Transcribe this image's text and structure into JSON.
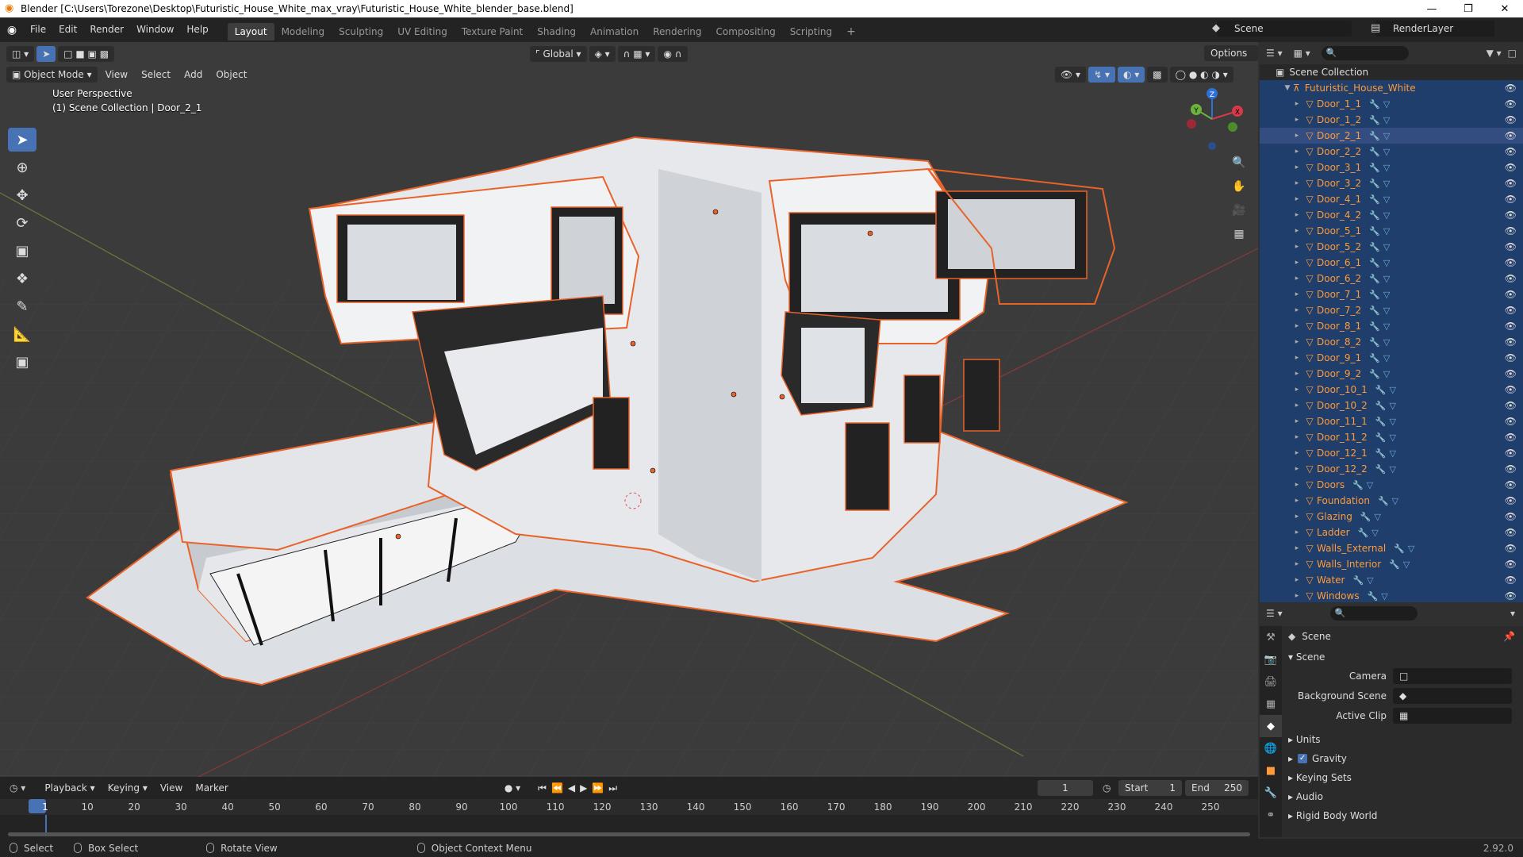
{
  "title": "Blender [C:\\Users\\Torezone\\Desktop\\Futuristic_House_White_max_vray\\Futuristic_House_White_blender_base.blend]",
  "menu": [
    "File",
    "Edit",
    "Render",
    "Window",
    "Help"
  ],
  "workspaces": [
    "Layout",
    "Modeling",
    "Sculpting",
    "UV Editing",
    "Texture Paint",
    "Shading",
    "Animation",
    "Rendering",
    "Compositing",
    "Scripting"
  ],
  "active_workspace": "Layout",
  "scene_name": "Scene",
  "render_layer": "RenderLayer",
  "viewport": {
    "mode": "Object Mode",
    "menus": [
      "View",
      "Select",
      "Add",
      "Object"
    ],
    "transform_orientation": "Global",
    "options_label": "Options",
    "perspective": "User Perspective",
    "collection_info": "(1) Scene Collection | Door_2_1"
  },
  "gizmo_axes": [
    "X",
    "Y",
    "Z"
  ],
  "outliner": {
    "root": "Scene Collection",
    "collection": "Futuristic_House_White",
    "items": [
      "Door_1_1",
      "Door_1_2",
      "Door_2_1",
      "Door_2_2",
      "Door_3_1",
      "Door_3_2",
      "Door_4_1",
      "Door_4_2",
      "Door_5_1",
      "Door_5_2",
      "Door_6_1",
      "Door_6_2",
      "Door_7_1",
      "Door_7_2",
      "Door_8_1",
      "Door_8_2",
      "Door_9_1",
      "Door_9_2",
      "Door_10_1",
      "Door_10_2",
      "Door_11_1",
      "Door_11_2",
      "Door_12_1",
      "Door_12_2",
      "Doors",
      "Foundation",
      "Glazing",
      "Ladder",
      "Walls_External",
      "Walls_Interior",
      "Water",
      "Windows"
    ],
    "selected": "Door_2_1"
  },
  "properties": {
    "context": "Scene",
    "section": "Scene",
    "fields": [
      {
        "label": "Camera",
        "value": ""
      },
      {
        "label": "Background Scene",
        "value": ""
      },
      {
        "label": "Active Clip",
        "value": ""
      }
    ],
    "panels": [
      "Units",
      "Gravity",
      "Keying Sets",
      "Audio",
      "Rigid Body World"
    ],
    "gravity_checked": true
  },
  "timeline": {
    "menus": [
      "Playback",
      "Keying",
      "View",
      "Marker"
    ],
    "current_frame": "1",
    "start_label": "Start",
    "start": "1",
    "end_label": "End",
    "end": "250",
    "ticks": [
      "1",
      "10",
      "20",
      "30",
      "40",
      "50",
      "60",
      "70",
      "80",
      "90",
      "100",
      "110",
      "120",
      "130",
      "140",
      "150",
      "160",
      "170",
      "180",
      "190",
      "200",
      "210",
      "220",
      "230",
      "240",
      "250"
    ]
  },
  "status": {
    "items": [
      "Select",
      "Box Select",
      "Rotate View",
      "Object Context Menu"
    ],
    "version": "2.92.0"
  },
  "colors": {
    "selected_text": "#ff9b39",
    "accent": "#4772b3",
    "outline": "#e8632a"
  }
}
